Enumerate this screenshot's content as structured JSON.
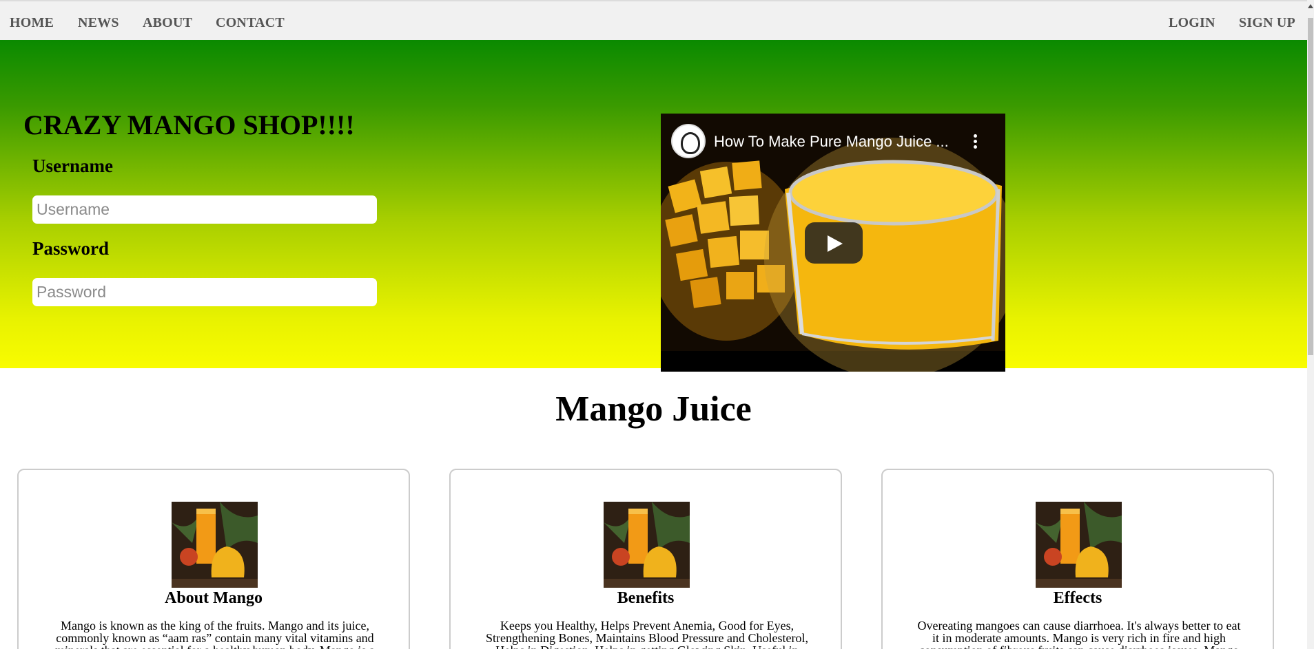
{
  "nav": {
    "home": "HOME",
    "news": "NEWS",
    "about": "ABOUT",
    "contact": "CONTACT",
    "login": "LOGIN",
    "signup": "SIGN UP"
  },
  "hero": {
    "title": "CRAZY MANGO SHOP!!!!",
    "username_label": "Username",
    "username_placeholder": "Username",
    "password_label": "Password",
    "password_placeholder": "Password",
    "gradient_top": "#0a8a00",
    "gradient_bottom": "#f9fc00"
  },
  "video": {
    "title": "How To Make Pure Mango Juice ..."
  },
  "section": {
    "title": "Mango Juice"
  },
  "cards": [
    {
      "title": "About Mango",
      "text": "Mango is known as the king of the fruits. Mango and its juice, commonly known as “aam ras” contain many vital vitamins and minerals that are essential for a healthy human body. Mango is a"
    },
    {
      "title": "Benefits",
      "text": "Keeps you Healthy, Helps Prevent Anemia, Good for Eyes, Strengthening Bones, Maintains Blood Pressure and Cholesterol, Helps in Digestion, Helps in getting Glowing Skin, Useful in"
    },
    {
      "title": "Effects",
      "text": "Overeating mangoes can cause diarrhoea. It's always better to eat it in moderate amounts. Mango is very rich in fire and high consumption of fibrous fruits can cause diarrhoea issues. Mango"
    }
  ]
}
